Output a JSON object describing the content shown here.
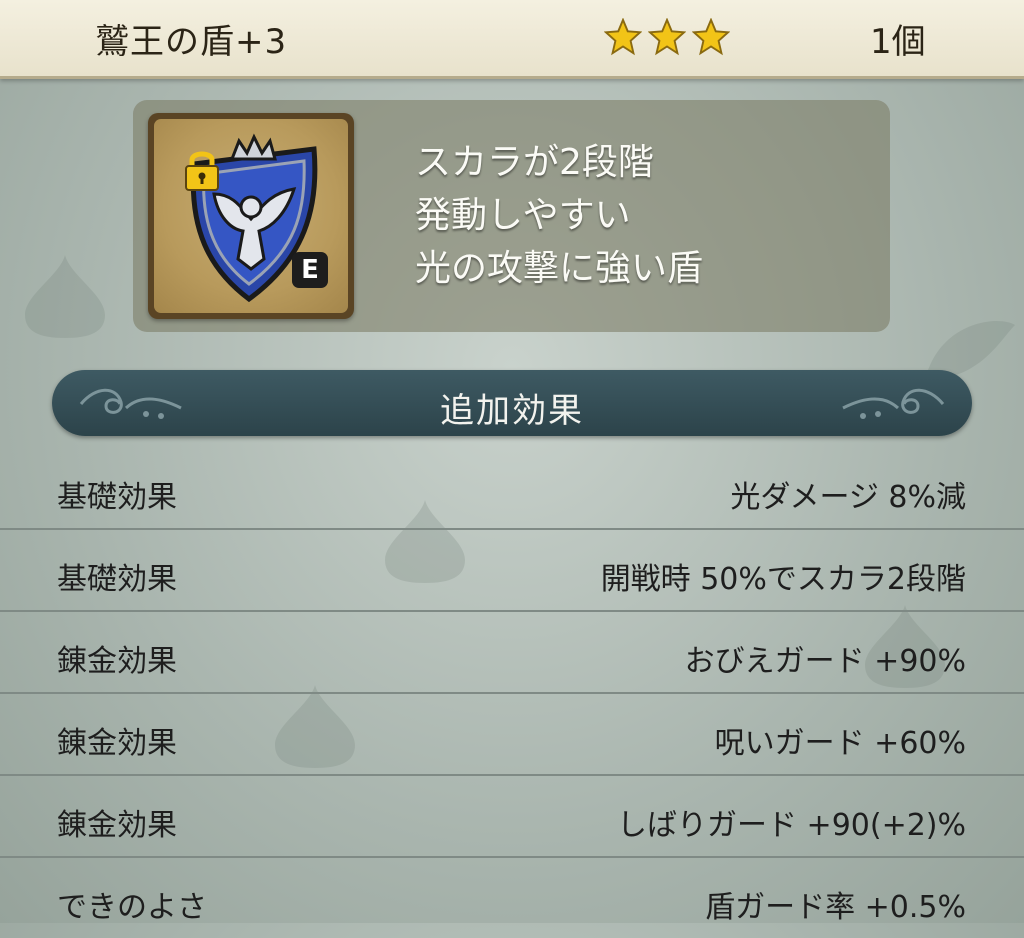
{
  "header": {
    "item_name": "鷲王の盾+3",
    "star_count": 3,
    "count": "1個"
  },
  "item": {
    "icon": "eagle-shield-icon",
    "locked": true,
    "equipped_badge": "E",
    "description": [
      "スカラが2段階",
      "発動しやすい",
      "光の攻撃に強い盾"
    ]
  },
  "section": {
    "title": "追加効果"
  },
  "effects": [
    {
      "label": "基礎効果",
      "value": "光ダメージ 8%減"
    },
    {
      "label": "基礎効果",
      "value": "開戦時 50%でスカラ2段階"
    },
    {
      "label": "錬金効果",
      "value": "おびえガード +90%"
    },
    {
      "label": "錬金効果",
      "value": "呪いガード +60%"
    },
    {
      "label": "錬金効果",
      "value": "しばりガード +90(+2)%"
    },
    {
      "label": "できのよさ",
      "value": "盾ガード率 +0.5%"
    }
  ],
  "colors": {
    "star": "#f2c417",
    "banner": "#2f4a52",
    "shield_blue": "#2a46a8"
  }
}
